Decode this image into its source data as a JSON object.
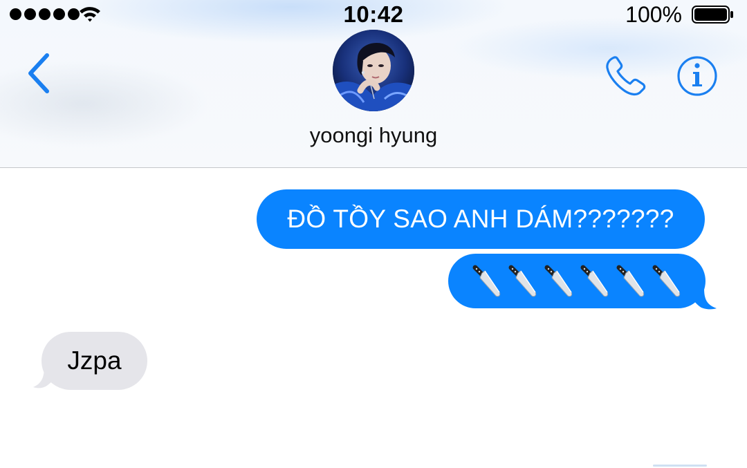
{
  "status_bar": {
    "time": "10:42",
    "battery_percent": "100%",
    "signal_bars": 5,
    "icons": [
      "signal-dots",
      "wifi-icon",
      "battery-icon"
    ]
  },
  "nav": {
    "back_icon": "chevron-left-icon",
    "contact_name": "yoongi hyung",
    "avatar_icon": "contact-avatar",
    "call_icon": "phone-icon",
    "info_icon": "info-icon"
  },
  "messages": [
    {
      "direction": "sent",
      "text": "ĐỒ TỒY SAO ANH DÁM???????"
    },
    {
      "direction": "sent",
      "emoji": "kitchen-knife-icon",
      "count": 6
    },
    {
      "direction": "received",
      "text": "Jzpa"
    }
  ],
  "colors": {
    "accent": "#0a84ff",
    "sent_bubble": "#0a84ff",
    "received_bubble": "#e5e5ea",
    "icon_blue": "#1a7ff0"
  }
}
